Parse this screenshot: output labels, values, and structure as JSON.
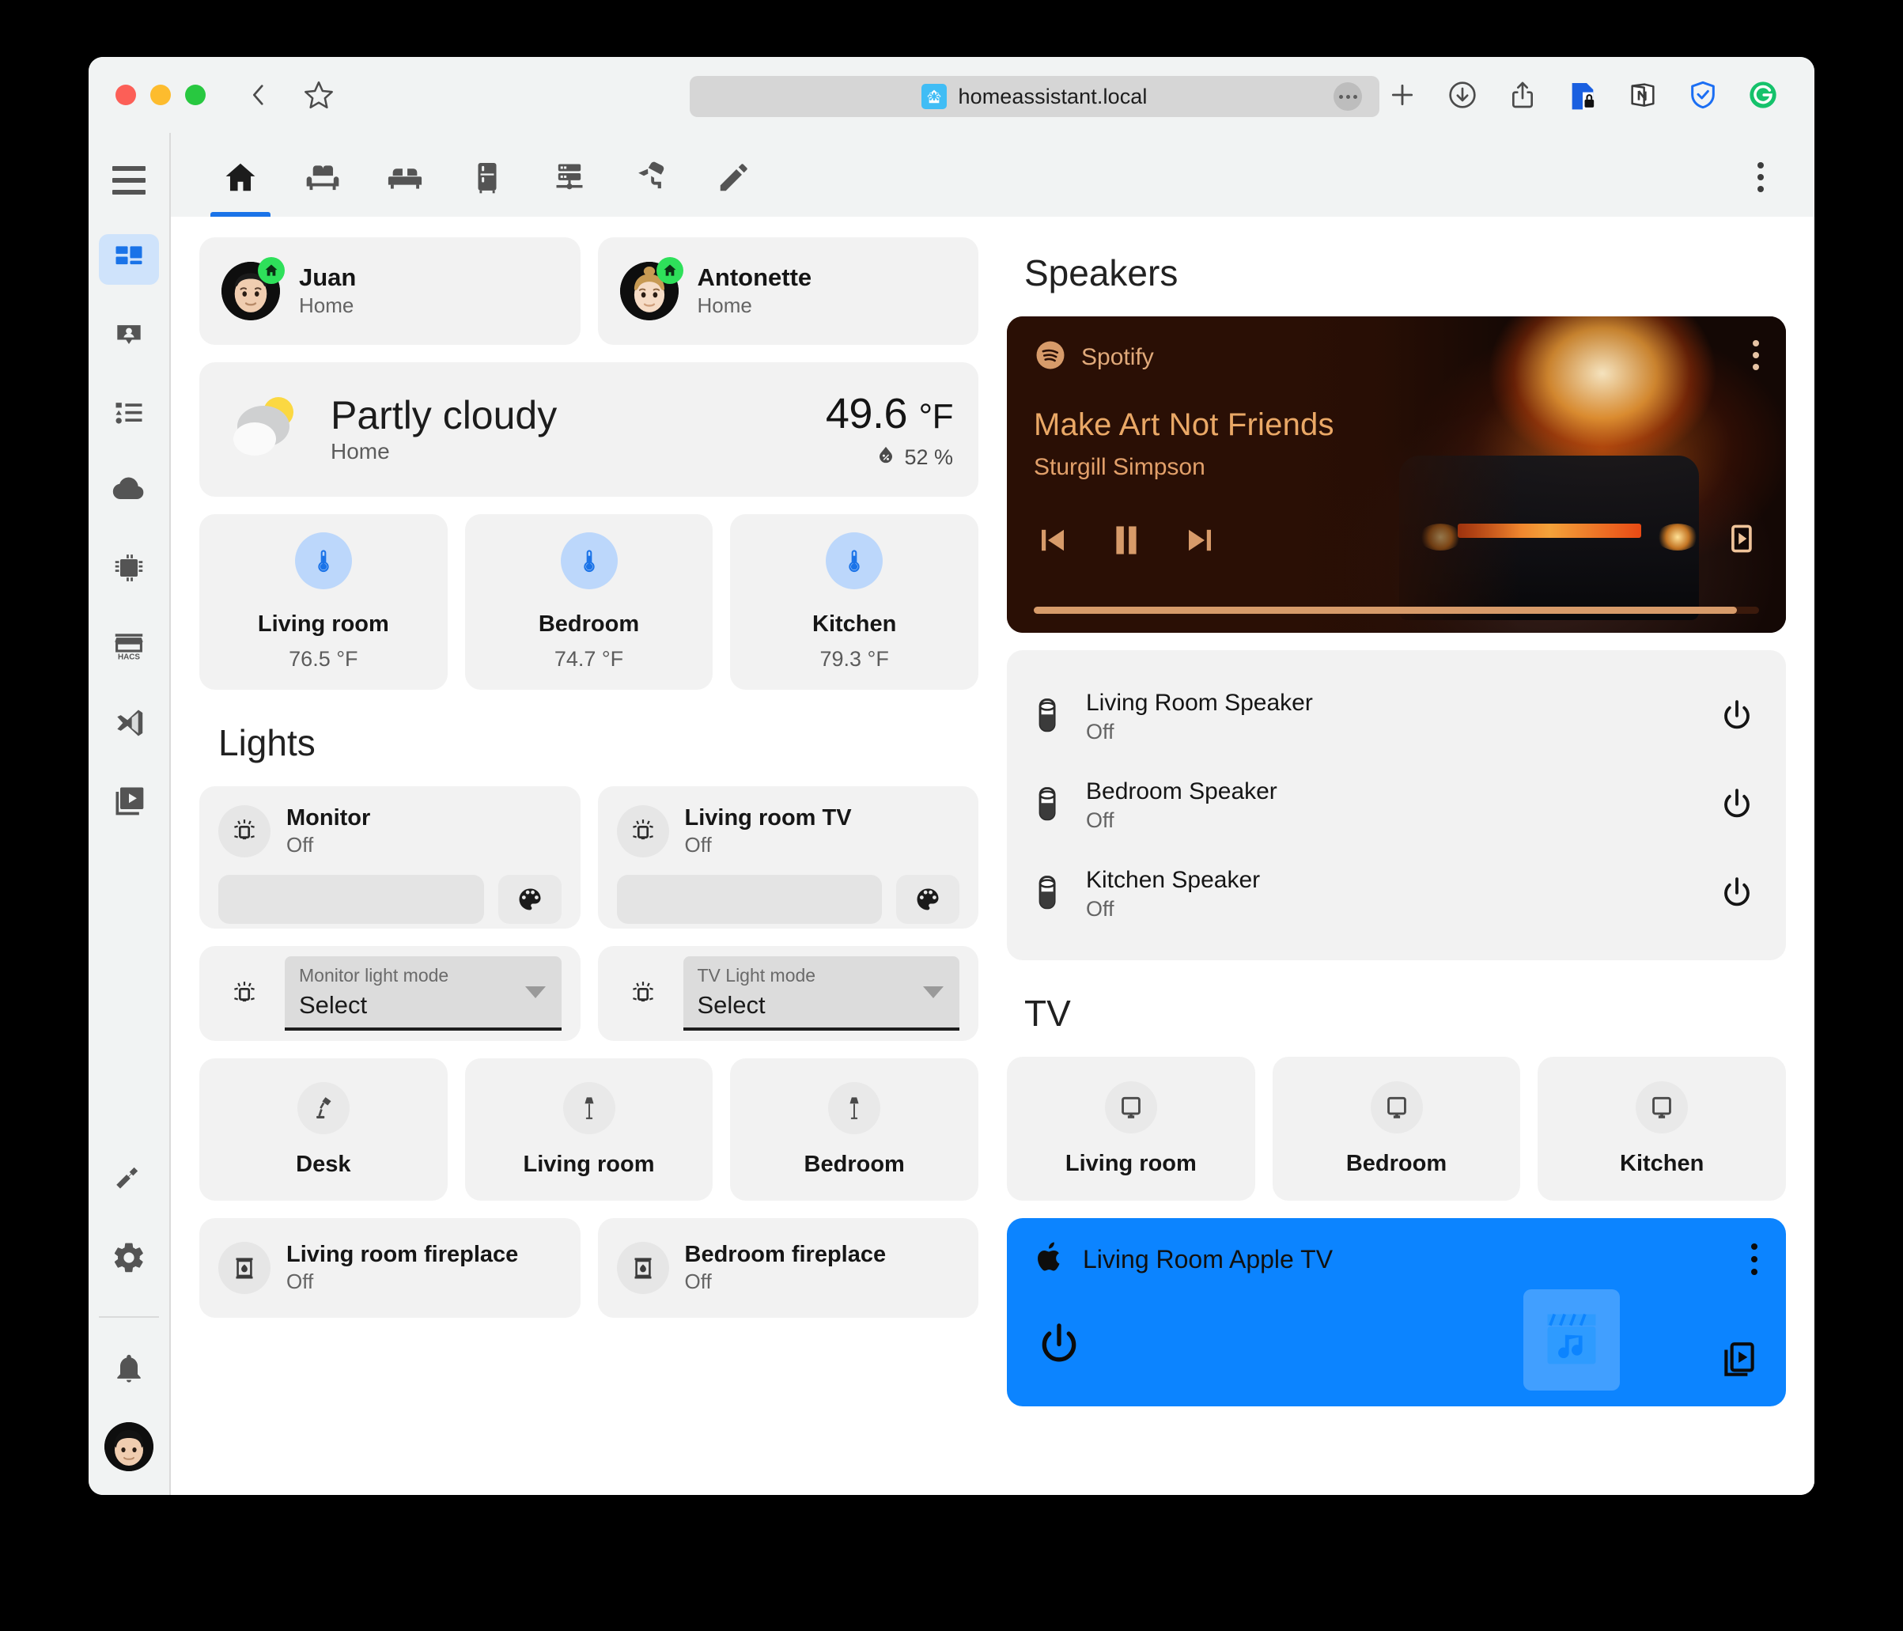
{
  "browser": {
    "url": "homeassistant.local",
    "favicon_icon": "home-assistant-favicon",
    "back_icon": "back-chevron-icon",
    "bookmark_icon": "star-icon",
    "more_icon": "url-more-icon",
    "extensions": [
      {
        "name": "new-tab-icon",
        "label": "+"
      },
      {
        "name": "downloads-icon",
        "label": "Downloads"
      },
      {
        "name": "share-icon",
        "label": "Share"
      },
      {
        "name": "password-manager-icon",
        "label": "1Password"
      },
      {
        "name": "notion-icon",
        "label": "Notion"
      },
      {
        "name": "adguard-icon",
        "label": "AdGuard"
      },
      {
        "name": "grammarly-icon",
        "label": "Grammarly"
      }
    ]
  },
  "sidebar": {
    "menu_label": "Menu",
    "items": [
      {
        "name": "dashboard",
        "icon": "view-dashboard-icon",
        "active": true
      },
      {
        "name": "map",
        "icon": "map-person-icon",
        "active": false
      },
      {
        "name": "logbook",
        "icon": "logbook-list-icon",
        "active": false
      },
      {
        "name": "weather",
        "icon": "cloud-icon",
        "active": false
      },
      {
        "name": "esphome",
        "icon": "chip-icon",
        "active": false
      },
      {
        "name": "hacs",
        "icon": "hacs-store-icon",
        "label": "HACS",
        "active": false
      },
      {
        "name": "vscode",
        "icon": "vscode-icon",
        "active": false
      },
      {
        "name": "media",
        "icon": "media-player-icon",
        "active": false
      }
    ],
    "bottom_items": [
      {
        "name": "developer-tools",
        "icon": "hammer-icon"
      },
      {
        "name": "settings",
        "icon": "gear-icon"
      },
      {
        "name": "notifications",
        "icon": "bell-icon"
      },
      {
        "name": "user-profile",
        "icon": "avatar-icon"
      }
    ]
  },
  "toolbar": {
    "tabs": [
      {
        "name": "tab-home",
        "icon": "home-icon",
        "active": true
      },
      {
        "name": "tab-living-room",
        "icon": "sofa-icon",
        "active": false
      },
      {
        "name": "tab-bedroom",
        "icon": "bed-icon",
        "active": false
      },
      {
        "name": "tab-kitchen",
        "icon": "fridge-icon",
        "active": false
      },
      {
        "name": "tab-network",
        "icon": "server-network-icon",
        "active": false
      },
      {
        "name": "tab-cameras",
        "icon": "cctv-icon",
        "active": false
      },
      {
        "name": "tab-edit",
        "icon": "pencil-icon",
        "active": false
      }
    ],
    "overflow_label": "More options"
  },
  "people": [
    {
      "name": "Juan",
      "state": "Home",
      "badge": "home-badge-icon"
    },
    {
      "name": "Antonette",
      "state": "Home",
      "badge": "home-badge-icon"
    }
  ],
  "weather": {
    "condition": "Partly cloudy",
    "location": "Home",
    "temperature": "49.6",
    "temperature_unit": "°F",
    "humidity": "52 %",
    "humidity_icon": "water-percent-icon",
    "icon": "partly-cloudy-icon"
  },
  "temperatures": [
    {
      "room": "Living room",
      "value": "76.5 °F",
      "icon": "thermometer-icon"
    },
    {
      "room": "Bedroom",
      "value": "74.7 °F",
      "icon": "thermometer-icon"
    },
    {
      "room": "Kitchen",
      "value": "79.3 °F",
      "icon": "thermometer-icon"
    }
  ],
  "lights": {
    "title": "Lights",
    "cards": [
      {
        "name": "Monitor",
        "state": "Off",
        "icon": "led-strip-icon",
        "palette_icon": "palette-icon",
        "brightness_slider": "brightness-slider"
      },
      {
        "name": "Living room TV",
        "state": "Off",
        "icon": "led-strip-icon",
        "palette_icon": "palette-icon",
        "brightness_slider": "brightness-slider"
      }
    ],
    "selects": [
      {
        "label": "Monitor light mode",
        "value": "Select",
        "icon": "led-strip-icon"
      },
      {
        "label": "TV Light mode",
        "value": "Select",
        "icon": "led-strip-icon"
      }
    ],
    "lamps": [
      {
        "name": "Desk",
        "icon": "desk-lamp-icon"
      },
      {
        "name": "Living room",
        "icon": "floor-lamp-icon"
      },
      {
        "name": "Bedroom",
        "icon": "floor-lamp-icon"
      }
    ],
    "fireplaces": [
      {
        "name": "Living room fireplace",
        "state": "Off",
        "icon": "fireplace-icon"
      },
      {
        "name": "Bedroom fireplace",
        "state": "Off",
        "icon": "fireplace-icon"
      }
    ]
  },
  "speakers": {
    "title": "Speakers",
    "player": {
      "source": "Spotify",
      "source_icon": "spotify-icon",
      "track": "Make Art Not Friends",
      "artist": "Sturgill Simpson",
      "previous_icon": "skip-previous-icon",
      "pause_icon": "pause-icon",
      "next_icon": "skip-next-icon",
      "cast_icon": "cast-icon",
      "overflow_icon": "kebab-icon",
      "progress_percent": 97,
      "accent_color": "#e0a97a",
      "background_color": "#2a0f05"
    },
    "list": [
      {
        "name": "Living Room Speaker",
        "state": "Off",
        "icon": "nest-mini-icon",
        "power_icon": "power-icon"
      },
      {
        "name": "Bedroom Speaker",
        "state": "Off",
        "icon": "nest-mini-icon",
        "power_icon": "power-icon"
      },
      {
        "name": "Kitchen Speaker",
        "state": "Off",
        "icon": "nest-mini-icon",
        "power_icon": "power-icon"
      }
    ]
  },
  "tv": {
    "title": "TV",
    "tiles": [
      {
        "name": "Living room",
        "icon": "television-icon"
      },
      {
        "name": "Bedroom",
        "icon": "television-icon"
      },
      {
        "name": "Kitchen",
        "icon": "television-icon"
      }
    ],
    "appletv": {
      "name": "Living Room Apple TV",
      "brand_icon": "apple-icon",
      "power_icon": "power-icon",
      "art_icon": "movie-music-icon",
      "browse_icon": "browse-media-icon",
      "overflow_icon": "kebab-icon",
      "accent_color": "#0c84ff"
    }
  }
}
